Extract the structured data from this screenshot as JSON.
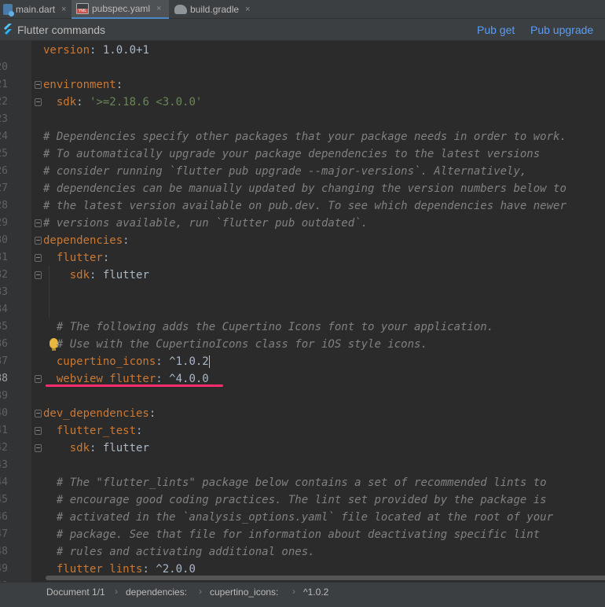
{
  "tabs": [
    {
      "label": "main.dart",
      "icon": "dart-file-icon",
      "active": false
    },
    {
      "label": "pubspec.yaml",
      "icon": "yaml-file-icon",
      "active": true
    },
    {
      "label": "build.gradle",
      "icon": "gradle-file-icon",
      "active": false
    }
  ],
  "tab_close_glyph": "×",
  "commands_bar": {
    "title": "Flutter commands",
    "pub_get": "Pub get",
    "pub_upgrade": "Pub upgrade"
  },
  "editor": {
    "line_numbers": [
      "20",
      "21",
      "22",
      "23",
      "24",
      "25",
      "26",
      "27",
      "28",
      "29",
      "30",
      "31",
      "32",
      "33",
      "34",
      "35",
      "36",
      "37",
      "38",
      "39",
      "40",
      "41",
      "42",
      "43",
      "44",
      "45",
      "46",
      "47",
      "48",
      "49",
      "50"
    ],
    "current_line": "38",
    "lines": {
      "l20_key": "version",
      "l20_colon": ": ",
      "l20_val": "1.0.0+1",
      "l22_key": "environment",
      "l22_colon": ":",
      "l23_key": "sdk",
      "l23_colon": ": ",
      "l23_val": "'>=2.18.6 <3.0.0'",
      "l25": "# Dependencies specify other packages that your package needs in order to work.",
      "l26": "# To automatically upgrade your package dependencies to the latest versions",
      "l27": "# consider running `flutter pub upgrade --major-versions`. Alternatively,",
      "l28": "# dependencies can be manually updated by changing the version numbers below to",
      "l29": "# the latest version available on pub.dev. To see which dependencies have newer",
      "l30": "# versions available, run `flutter pub outdated`.",
      "l31_key": "dependencies",
      "l31_colon": ":",
      "l32_key": "flutter",
      "l32_colon": ":",
      "l33_key": "sdk",
      "l33_colon": ": ",
      "l33_val": "flutter",
      "l36": "# The following adds the Cupertino Icons font to your application.",
      "l37": "# Use with the CupertinoIcons class for iOS style icons.",
      "l38_key": "cupertino_icons",
      "l38_colon": ": ",
      "l38_val": "^1.0.2",
      "l39_key": "webview_flutter",
      "l39_colon": ": ",
      "l39_val": "^4.0.0",
      "l41_key": "dev_dependencies",
      "l41_colon": ":",
      "l42_key": "flutter_test",
      "l42_colon": ":",
      "l43_key": "sdk",
      "l43_colon": ": ",
      "l43_val": "flutter",
      "l45": "# The \"flutter_lints\" package below contains a set of recommended lints to",
      "l46": "# encourage good coding practices. The lint set provided by the package is",
      "l47": "# activated in the `analysis_options.yaml` file located at the root of your",
      "l48": "# package. See that file for information about deactivating specific lint",
      "l49": "# rules and activating additional ones.",
      "l50_key": "flutter_lints",
      "l50_colon": ": ",
      "l50_val": "^2.0.0"
    }
  },
  "breadcrumb": {
    "items": [
      "Document 1/1",
      "dependencies:",
      "cupertino_icons:",
      "^1.0.2"
    ],
    "separator": "›"
  },
  "colors": {
    "background": "#2b2b2b",
    "key": "#cc7832",
    "string": "#6a8759",
    "comment": "#808080",
    "text": "#a9b7c6",
    "link": "#589df6",
    "highlight_underline": "#ff2d6f"
  }
}
